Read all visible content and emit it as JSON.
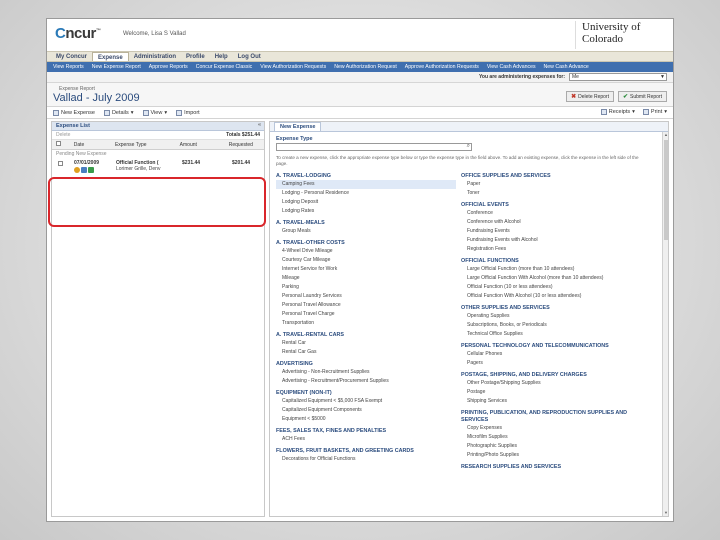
{
  "header": {
    "logo_prefix": "C",
    "logo_rest": "ncur",
    "logo_mark": "™",
    "welcome": "Welcome, Lisa S Vallad",
    "university_line1": "University of",
    "university_line2": "Colorado"
  },
  "nav_main": [
    "My Concur",
    "Expense",
    "Administration",
    "Profile",
    "Help",
    "Log Out"
  ],
  "nav_sub": [
    "View Reports",
    "New Expense Report",
    "Approve Reports",
    "Concur Expense Classic",
    "View Authorization Requests",
    "New Authorization Request",
    "Approve Authorization Requests",
    "View Cash Advances",
    "New Cash Advance"
  ],
  "admin_bar": {
    "label": "You are administering expenses for:",
    "selected": "Me"
  },
  "report": {
    "subtitle": "Expense Report",
    "name": "Vallad - July 2009",
    "delete_label": "Delete Report",
    "submit_label": "Submit Report"
  },
  "toolbar": {
    "new_expense": "New Expense",
    "details": "Details",
    "view": "View",
    "import": "Import",
    "receipts": "Receipts",
    "print": "Print"
  },
  "expense_list": {
    "title": "Expense List",
    "delete": "Delete",
    "totals": "Totals $251.44",
    "columns": [
      "Date",
      "Expense Type",
      "Amount",
      "Requested"
    ],
    "new_label": "Pending New Expense",
    "rows": [
      {
        "date": "07/01/2009",
        "type": "Official Function (",
        "vendor": "Lorimer Grille, Denv",
        "amount": "$231.44",
        "requested": "$201.44"
      }
    ]
  },
  "new_expense": {
    "tab": "New Expense",
    "field_label": "Expense Type",
    "instructions": "To create a new expense, click the appropriate expense type below or type the expense type in the field above. To add an existing expense, click the expense in the left side of the page."
  },
  "categories_left": [
    {
      "title": "A. TRAVEL-LODGING",
      "items": [
        "Camping Fees",
        "Lodging - Personal Residence",
        "Lodging Deposit",
        "Lodging Rates"
      ]
    },
    {
      "title": "A. TRAVEL-MEALS",
      "items": [
        "Group Meals"
      ]
    },
    {
      "title": "A. TRAVEL-OTHER COSTS",
      "items": [
        "4-Wheel Drive Mileage",
        "Courtesy Car Mileage",
        "Internet Service for Work",
        "Mileage",
        "Parking",
        "Personal Laundry Services",
        "Personal Travel Allowance",
        "Personal Travel Charge",
        "Transportation"
      ]
    },
    {
      "title": "A. TRAVEL-RENTAL CARS",
      "items": [
        "Rental Car",
        "Rental Car Gas"
      ]
    },
    {
      "title": "ADVERTISING",
      "items": [
        "Advertising - Non-Recruitment Supplies",
        "Advertising - Recruitment/Procurement Supplies"
      ]
    },
    {
      "title": "EQUIPMENT (NON-IT)",
      "items": [
        "Capitalized Equipment < $5,000 FSA Exempt",
        "Capitalized Equipment Components",
        "Equipment < $5000"
      ]
    },
    {
      "title": "FEES, SALES TAX, FINES AND PENALTIES",
      "items": [
        "ACH Fees"
      ]
    },
    {
      "title": "FLOWERS, FRUIT BASKETS, AND GREETING CARDS",
      "items": [
        "Decorations for Official Functions"
      ]
    }
  ],
  "categories_right": [
    {
      "title": "OFFICE SUPPLIES AND SERVICES",
      "items": [
        "Paper",
        "Toner"
      ]
    },
    {
      "title": "OFFICIAL EVENTS",
      "items": [
        "Conference",
        "Conference with Alcohol",
        "Fundraising Events",
        "Fundraising Events with Alcohol",
        "Registration Fees"
      ]
    },
    {
      "title": "OFFICIAL FUNCTIONS",
      "items": [
        "Large Official Function (more than 10 attendees)",
        "Large Official Function With Alcohol (more than 10 attendees)",
        "Official Function (10 or less attendees)",
        "Official Function With Alcohol (10 or less attendees)"
      ]
    },
    {
      "title": "OTHER SUPPLIES AND SERVICES",
      "items": [
        "Operating Supplies",
        "Subscriptions, Books, or Periodicals",
        "Technical Office Supplies"
      ]
    },
    {
      "title": "PERSONAL TECHNOLOGY AND TELECOMMUNICATIONS",
      "items": [
        "Cellular Phones",
        "Pagers"
      ]
    },
    {
      "title": "POSTAGE, SHIPPING, AND DELIVERY CHARGES",
      "items": [
        "Other Postage/Shipping Supplies",
        "Postage",
        "Shipping Services"
      ]
    },
    {
      "title": "PRINTING, PUBLICATION, AND REPRODUCTION SUPPLIES AND SERVICES",
      "items": [
        "Copy Expenses",
        "Microfilm Supplies",
        "Photographic Supplies",
        "Printing/Photo Supplies"
      ]
    },
    {
      "title": "RESEARCH SUPPLIES AND SERVICES",
      "items": []
    }
  ],
  "colors": {
    "accent": "#3f6faf",
    "highlight": "#d9262b",
    "link": "#2b4c7e"
  }
}
